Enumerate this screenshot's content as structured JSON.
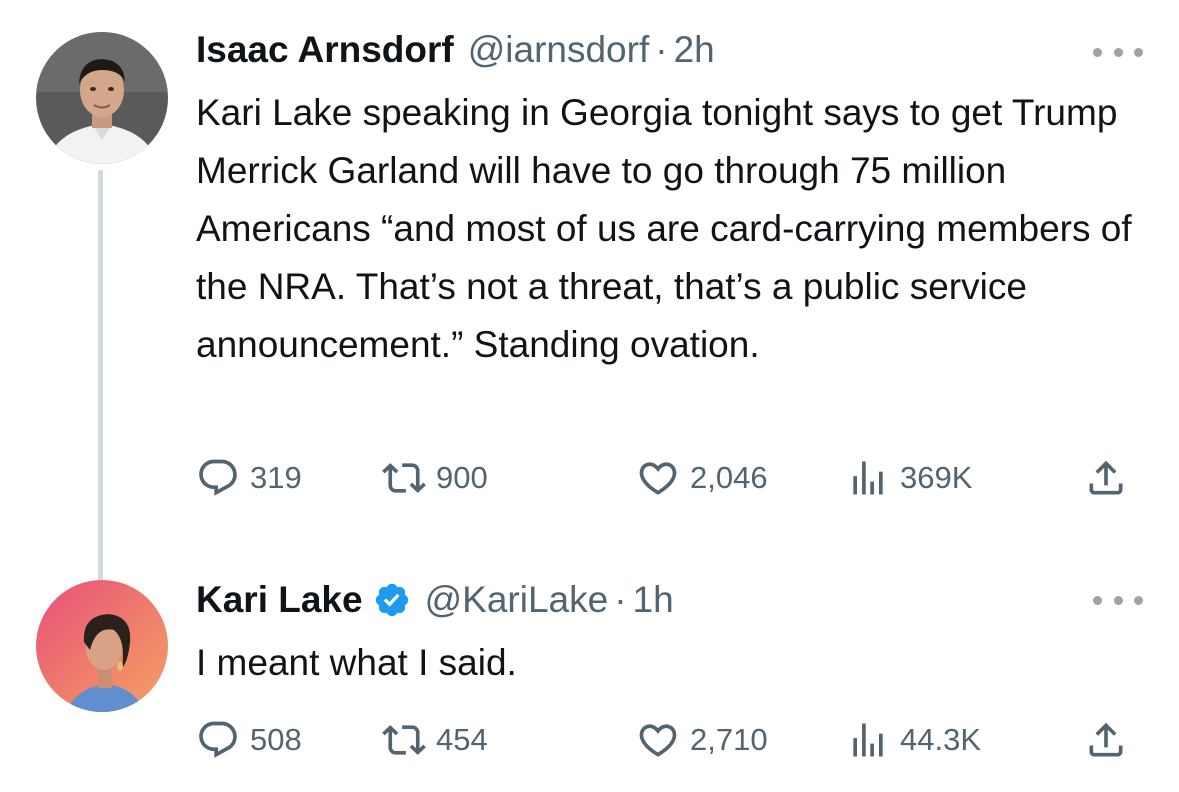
{
  "tweets": [
    {
      "display_name": "Isaac Arnsdorf",
      "handle": "@iarnsdorf",
      "separator": "·",
      "time": "2h",
      "text": "Kari Lake speaking in Georgia tonight says to get Trump Merrick Garland will have to go through 75 million Americans “and most of us are card-carrying members of the NRA. That’s not a threat, that’s a public service announcement.” Standing ovation.",
      "verified": false,
      "stats": {
        "replies": "319",
        "retweets": "900",
        "likes": "2,046",
        "views": "369K"
      }
    },
    {
      "display_name": "Kari Lake",
      "handle": "@KariLake",
      "separator": "·",
      "time": "1h",
      "text": "I meant what I said.",
      "verified": true,
      "stats": {
        "replies": "508",
        "retweets": "454",
        "likes": "2,710",
        "views": "44.3K"
      }
    }
  ],
  "icons": {
    "reply": "reply-icon",
    "retweet": "retweet-icon",
    "like": "heart-icon",
    "views": "views-icon",
    "share": "share-icon",
    "more": "more-icon",
    "verified": "verified-badge-icon"
  },
  "colors": {
    "text": "#0f1419",
    "secondary": "#536471",
    "thread_line": "#cfd9de",
    "verified_blue": "#1d9bf0"
  }
}
